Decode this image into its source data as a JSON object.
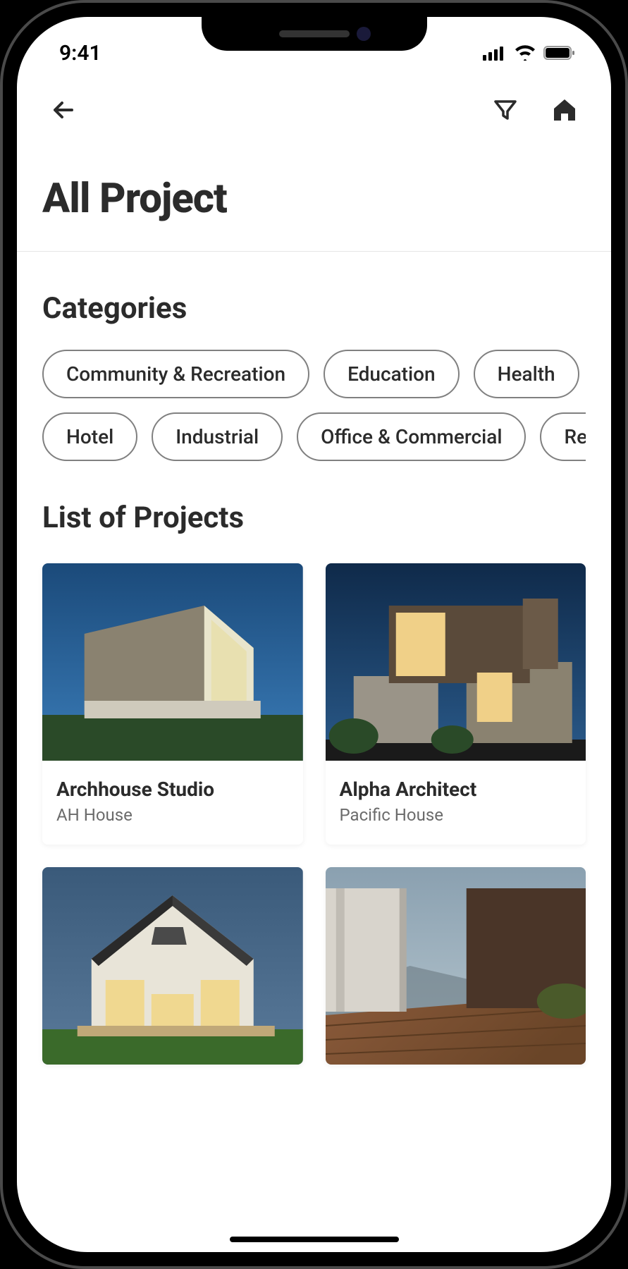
{
  "status": {
    "time": "9:41"
  },
  "header": {
    "title": "All Project"
  },
  "sections": {
    "categories_title": "Categories",
    "projects_title": "List of Projects"
  },
  "categories": {
    "row1": [
      "Community & Recreation",
      "Education",
      "Health"
    ],
    "row2": [
      "Hotel",
      "Industrial",
      "Office & Commercial",
      "Res"
    ]
  },
  "projects": [
    {
      "studio": "Archhouse Studio",
      "name": "AH  House"
    },
    {
      "studio": "Alpha Architect",
      "name": "Pacific House"
    },
    {
      "studio": "",
      "name": ""
    },
    {
      "studio": "",
      "name": ""
    }
  ]
}
